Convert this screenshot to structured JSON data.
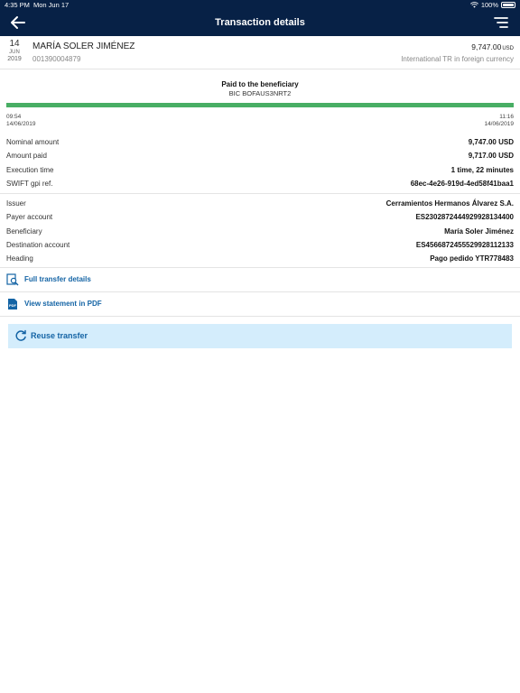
{
  "status_bar": {
    "time": "4:35 PM",
    "date": "Mon Jun 17",
    "battery": "100%"
  },
  "header": {
    "title": "Transaction details"
  },
  "summary": {
    "day": "14",
    "month": "JUN",
    "year": "2019",
    "name": "MARÍA SOLER JIMÉNEZ",
    "account": "001390004879",
    "amount": "9,747.00",
    "currency": "USD",
    "type": "International TR in foreign currency"
  },
  "tracking": {
    "title": "Paid to the beneficiary",
    "bic": "BIC BOFAUS3NRT2",
    "progress": 1.0,
    "start_time": "09:54",
    "start_date": "14/06/2019",
    "end_time": "11:16",
    "end_date": "14/06/2019"
  },
  "details": {
    "group1": [
      {
        "label": "Nominal amount",
        "value": "9,747.00 USD"
      },
      {
        "label": "Amount paid",
        "value": "9,717.00 USD"
      },
      {
        "label": "Execution time",
        "value": "1 time, 22 minutes"
      },
      {
        "label": "SWIFT gpi ref.",
        "value": "68ec-4e26-919d-4ed58f41baa1"
      }
    ],
    "group2": [
      {
        "label": "Issuer",
        "value": "Cerramientos Hermanos Álvarez S.A."
      },
      {
        "label": "Payer account",
        "value": "ES2302872444929928134400"
      },
      {
        "label": "Beneficiary",
        "value": "María Soler Jiménez"
      },
      {
        "label": "Destination account",
        "value": "ES4566872455529928112133"
      },
      {
        "label": "Heading",
        "value": "Pago pedido YTR778483"
      }
    ]
  },
  "actions": {
    "full_details": "Full transfer details",
    "statement_pdf": "View statement in PDF",
    "reuse": "Reuse transfer"
  },
  "colors": {
    "header": "#072146",
    "progress": "#48ae64",
    "link": "#1464a5",
    "reuse_bg": "#d4edfc"
  },
  "icons": {
    "back": "arrow-left-icon",
    "menu": "menu-icon",
    "details": "document-search-icon",
    "pdf": "pdf-icon",
    "reuse": "refresh-icon"
  }
}
